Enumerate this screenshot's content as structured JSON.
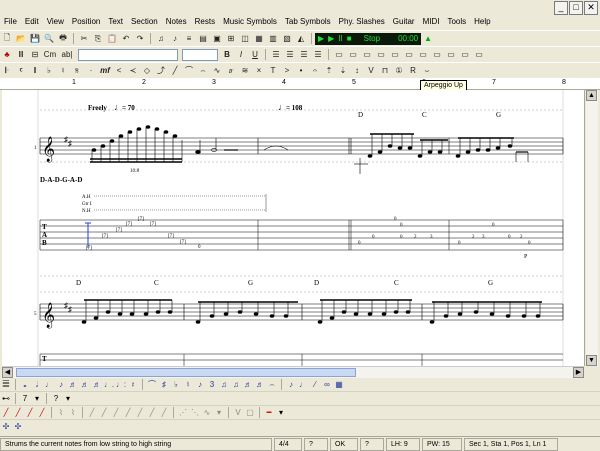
{
  "menus": [
    "File",
    "Edit",
    "View",
    "Position",
    "Text",
    "Section",
    "Notes",
    "Rests",
    "Music Symbols",
    "Tab Symbols",
    "Phy. Slashes",
    "Guitar",
    "MIDI",
    "Tools",
    "Help"
  ],
  "window_buttons": {
    "minimize": "_",
    "maximize": "□",
    "close": "✕"
  },
  "playback": {
    "play": "▶",
    "repeat": "▶",
    "pause": "II",
    "stop": "■",
    "mode": "Stop",
    "time": "00:00"
  },
  "formatting": {
    "bold": "B",
    "italic": "I",
    "underline": "U",
    "font_value": "",
    "size_value": ""
  },
  "ruler": {
    "ticks": [
      "1",
      "2",
      "3",
      "4",
      "5",
      "6",
      "7",
      "8"
    ]
  },
  "tooltip": "Arpeggio Up",
  "score": {
    "system1": {
      "tempo1_label": "Freely",
      "tempo1_value": "= 70",
      "tempo2_value": "= 108",
      "chords": [
        "D",
        "C",
        "G"
      ],
      "tuning": "D-A-D-G-A-D",
      "ahgroup": [
        "A.H",
        "Gtr I",
        "N.H"
      ],
      "tuplet": "10:8",
      "tab_harmonics": [
        "[7]",
        "[7]",
        "[7]",
        "[7]",
        "[7]",
        "[7]",
        "[7]",
        "[7]"
      ],
      "tab_numbers": [
        "0",
        "0",
        "0",
        "0",
        "2",
        "3",
        "0",
        "0",
        "2",
        "3",
        "0",
        "0",
        "2",
        "0",
        "0"
      ],
      "tab_label_letters": [
        "T",
        "A",
        "B"
      ],
      "pick_letter": "P",
      "measure_number": "1"
    },
    "system2": {
      "chords": [
        "D",
        "C",
        "G",
        "D",
        "C",
        "G"
      ],
      "measure_number": "5",
      "tab_letter": "T"
    }
  },
  "status": {
    "message": "Strums the current notes from low string to high string",
    "time_sig": "4/4",
    "q1": "?",
    "ok": "OK",
    "q2": "?",
    "lh": "LH: 9",
    "pw": "PW: 15",
    "position": "Sec 1, Sta 1, Pos 1, Ln 1"
  }
}
